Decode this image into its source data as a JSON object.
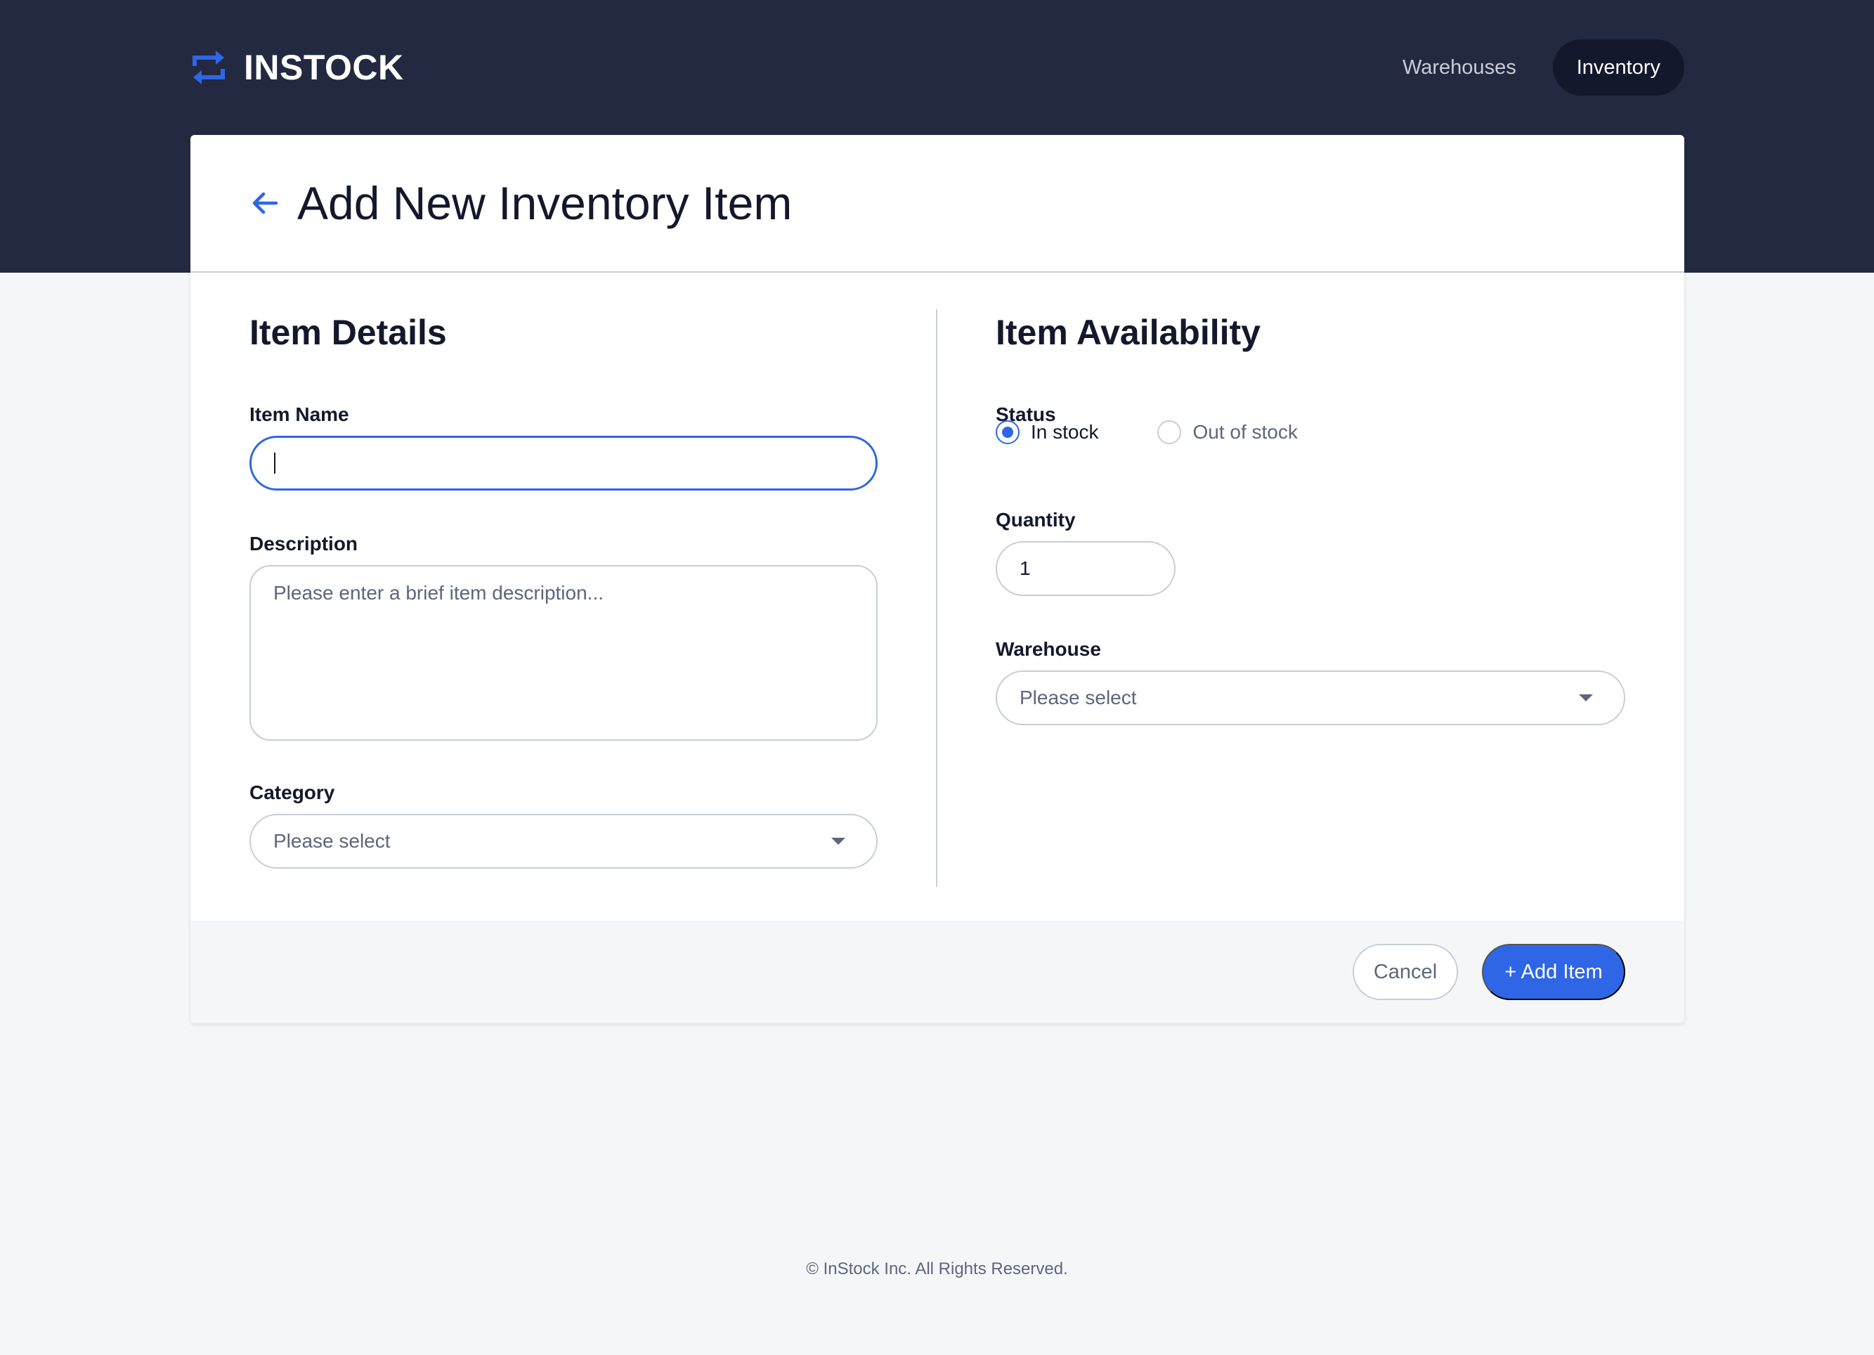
{
  "brand": {
    "name": "INSTOCK",
    "logo_icon": "swap-arrows-icon",
    "accent": "#2e66e6"
  },
  "nav": {
    "items": [
      {
        "label": "Warehouses",
        "active": false
      },
      {
        "label": "Inventory",
        "active": true
      }
    ]
  },
  "page": {
    "title": "Add New Inventory Item",
    "back_icon": "arrow-left-icon"
  },
  "details": {
    "title": "Item Details",
    "item_name": {
      "label": "Item Name",
      "value": ""
    },
    "description": {
      "label": "Description",
      "placeholder": "Please enter a brief item description..."
    },
    "category": {
      "label": "Category",
      "value": "Please select"
    }
  },
  "availability": {
    "title": "Item Availability",
    "status": {
      "label": "Status",
      "options": [
        {
          "label": "In stock",
          "checked": true
        },
        {
          "label": "Out of stock",
          "checked": false
        }
      ]
    },
    "quantity": {
      "label": "Quantity",
      "value": "1"
    },
    "warehouse": {
      "label": "Warehouse",
      "value": "Please select"
    }
  },
  "actions": {
    "cancel": "Cancel",
    "submit": "+ Add Item"
  },
  "footer": {
    "text": "© InStock Inc. All Rights Reserved."
  }
}
